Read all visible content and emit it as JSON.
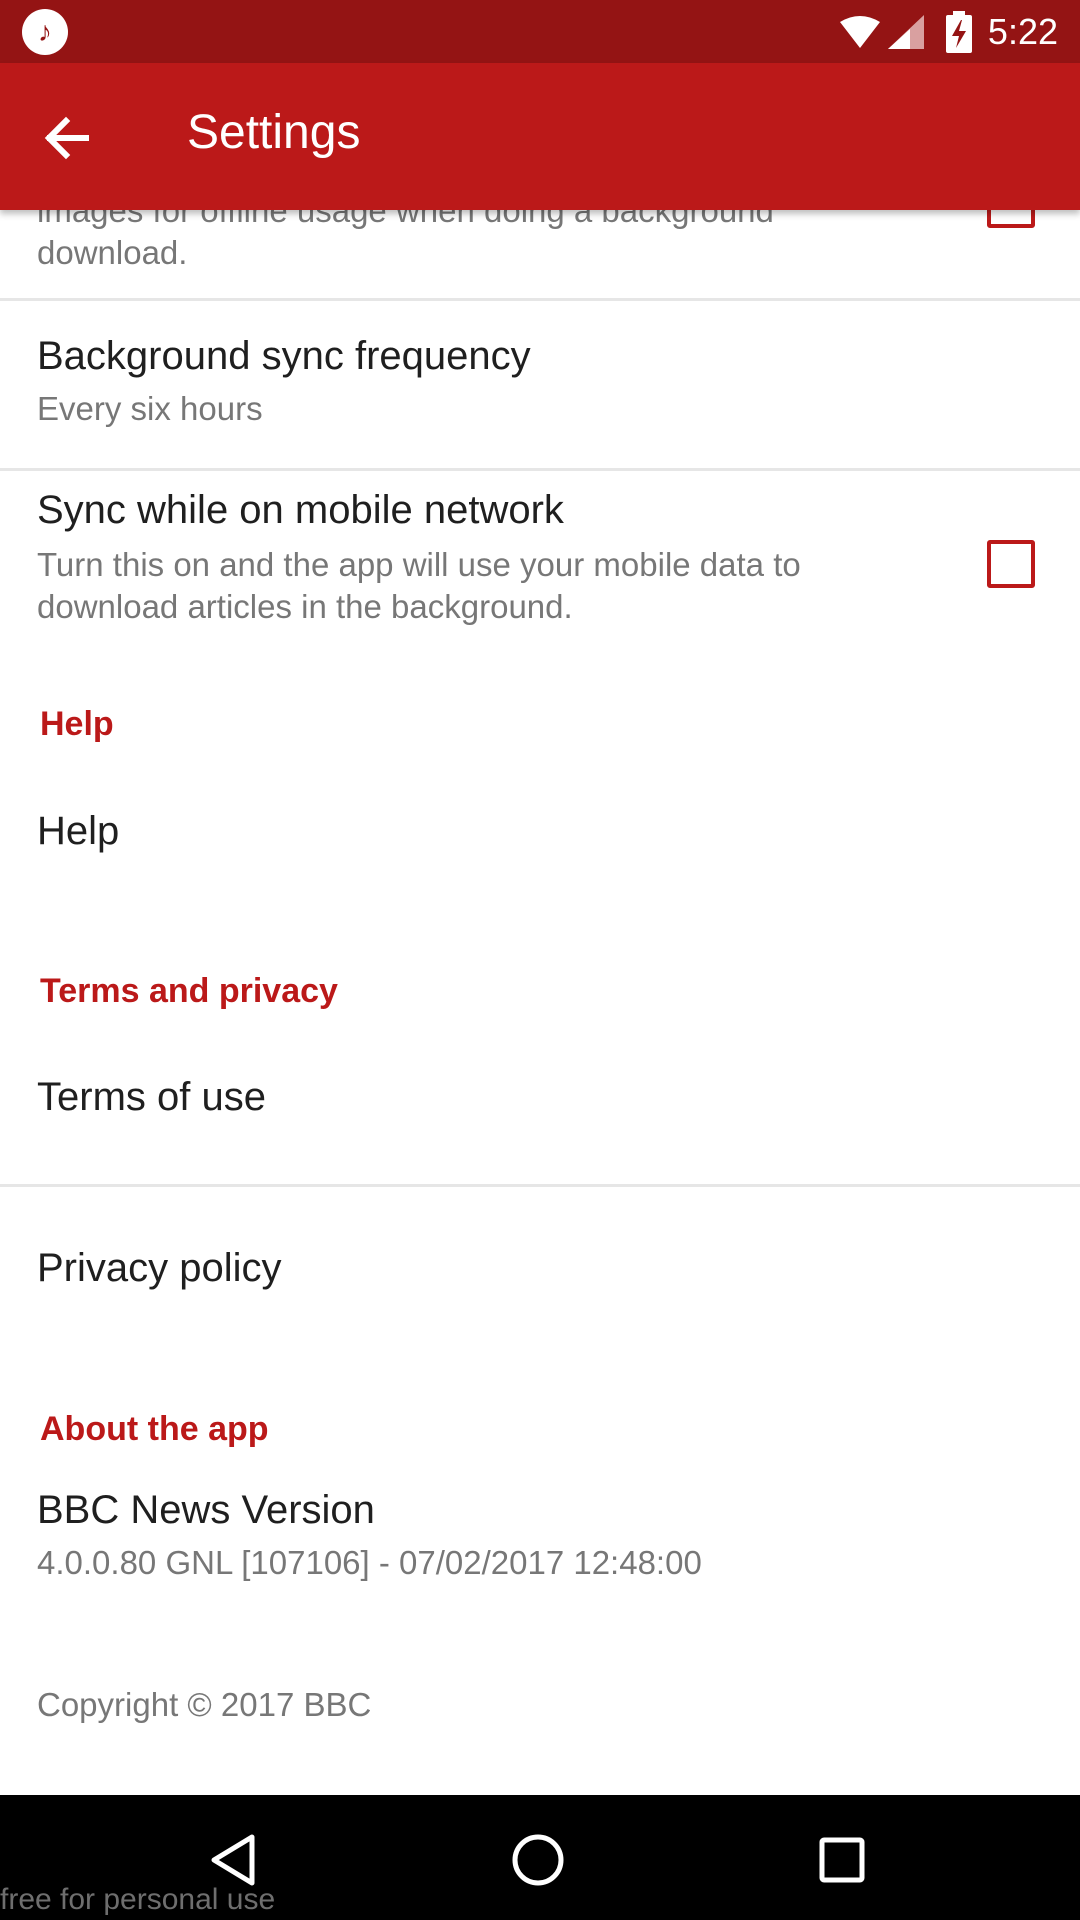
{
  "status_bar": {
    "time": "5:22",
    "app_icon": "bbc-news-icon",
    "icons": [
      "wifi-icon",
      "cellular-signal-icon",
      "battery-charging-icon"
    ]
  },
  "app_bar": {
    "title": "Settings",
    "back_icon": "back-arrow-icon"
  },
  "settings": {
    "partial_item": {
      "subtitle_line1": "images for offline usage when doing a background",
      "subtitle_line2": "download.",
      "checked": false
    },
    "background_sync": {
      "title": "Background sync frequency",
      "value": "Every six hours"
    },
    "mobile_sync": {
      "title": "Sync while on mobile network",
      "subtitle_line1": "Turn this on and the app will use your mobile data to",
      "subtitle_line2": "download articles in the background.",
      "checked": false
    },
    "help_section": {
      "header": "Help",
      "items": [
        "Help"
      ]
    },
    "terms_section": {
      "header": "Terms and privacy",
      "items": [
        "Terms of use",
        "Privacy policy"
      ]
    },
    "about_section": {
      "header": "About the app",
      "version_title": "BBC News Version",
      "version_value": "4.0.0.80 GNL [107106] - 07/02/2017 12:48:00",
      "copyright": "Copyright © 2017 BBC"
    }
  },
  "nav_bar": {
    "buttons": [
      "back-triangle-icon",
      "home-circle-icon",
      "recents-square-icon"
    ]
  },
  "watermark": "free for personal use",
  "colors": {
    "status_bar": "#941414",
    "app_bar": "#bb1919",
    "accent": "#bb1919",
    "text_primary": "#1f1f1f",
    "text_secondary": "#777777"
  }
}
